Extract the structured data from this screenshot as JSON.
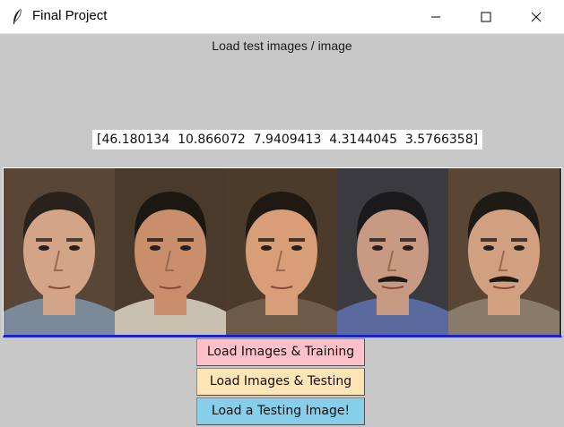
{
  "window": {
    "title": "Final Project",
    "controls": {
      "minimize": "minimize",
      "maximize": "maximize",
      "close": "close"
    }
  },
  "client": {
    "status_text": "Load test images / image",
    "result_vector": "[46.180134  10.866072  7.9409413  4.3144045  3.5766358]",
    "faces": [
      {
        "name": "face-1",
        "skin": "#d4a487",
        "hair": "#2a221c",
        "bg": "#5a4636",
        "shirt": "#7a8a9a"
      },
      {
        "name": "face-2",
        "skin": "#c98f6c",
        "hair": "#1d1712",
        "bg": "#4a3a2c",
        "shirt": "#c9c0b0"
      },
      {
        "name": "face-3",
        "skin": "#d79e78",
        "hair": "#1f1914",
        "bg": "#4c3a2b",
        "shirt": "#6e5a48"
      },
      {
        "name": "face-4",
        "skin": "#c89a84",
        "hair": "#1a1a1c",
        "bg": "#3b3a3e",
        "shirt": "#5a6a9e"
      },
      {
        "name": "face-5",
        "skin": "#d0a080",
        "hair": "#1e1a16",
        "bg": "#5a4634",
        "shirt": "#8a7a6a"
      }
    ],
    "strip_border_color": "#1a22d6"
  },
  "buttons": [
    {
      "label": "Load Images & Training",
      "color": "#ffc0cb"
    },
    {
      "label": "Load Images & Testing",
      "color": "#ffe4b5"
    },
    {
      "label": "Load a Testing Image!",
      "color": "#87ceeb"
    }
  ]
}
